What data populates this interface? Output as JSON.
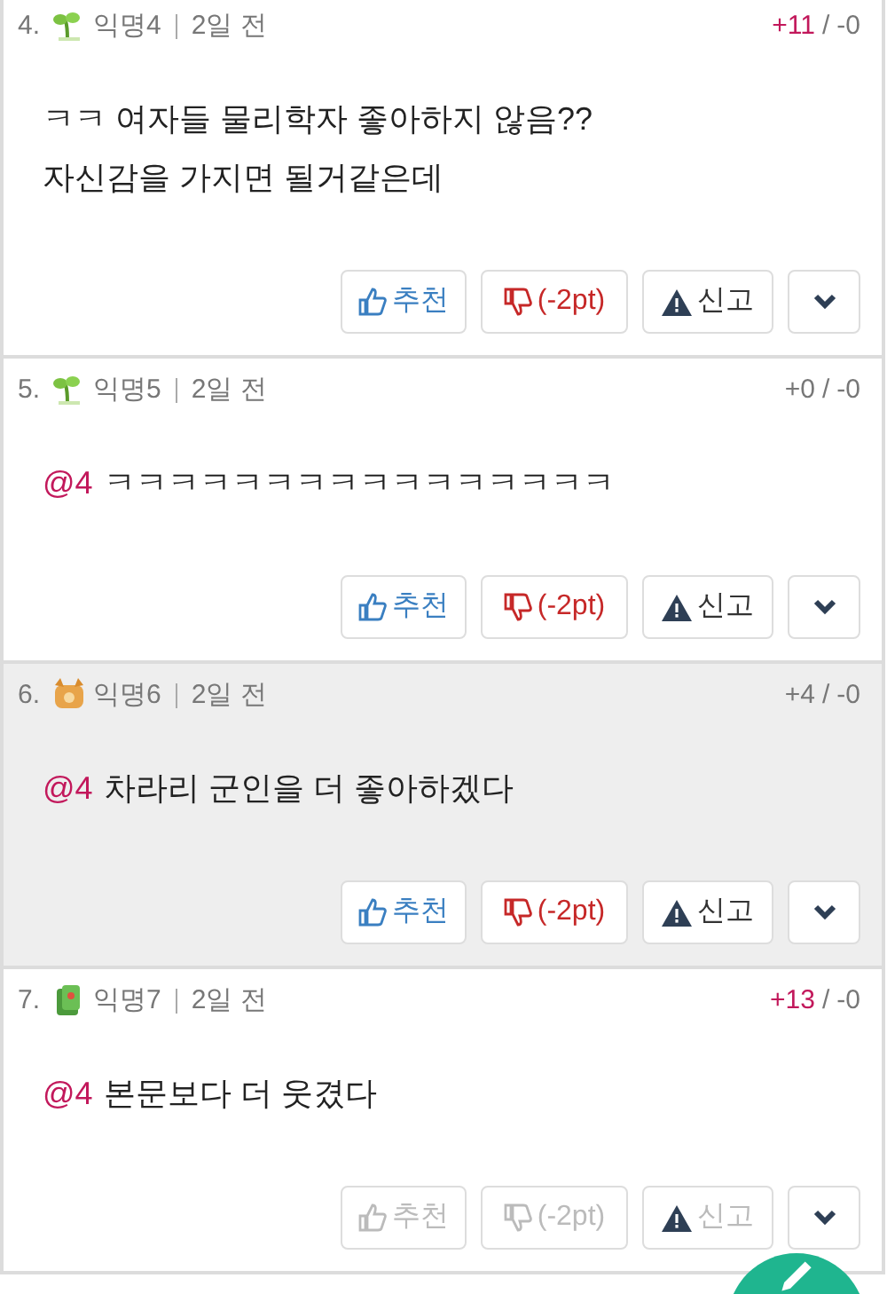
{
  "comments": [
    {
      "number": "4.",
      "avatar": {
        "kind": "sprout"
      },
      "author": "익명4",
      "time": "2일 전",
      "upvotes": "+11",
      "score_separator": "/",
      "downvotes": "-0",
      "hot": true,
      "highlighted": false,
      "lines": [
        "ㅋㅋ 여자들 물리학자 좋아하지 않음??",
        "자신감을 가지면 될거같은데"
      ],
      "buttons": {
        "like": "추천",
        "dislike": "(-2pt)",
        "report": "신고"
      },
      "disabled": false
    },
    {
      "number": "5.",
      "avatar": {
        "kind": "sprout"
      },
      "author": "익명5",
      "time": "2일 전",
      "upvotes": "+0",
      "score_separator": "/",
      "downvotes": "-0",
      "hot": false,
      "highlighted": false,
      "mention": "@4",
      "lines": [
        "ㅋㅋㅋㅋㅋㅋㅋㅋㅋㅋㅋㅋㅋㅋㅋㅋ"
      ],
      "buttons": {
        "like": "추천",
        "dislike": "(-2pt)",
        "report": "신고"
      },
      "disabled": false
    },
    {
      "number": "6.",
      "avatar": {
        "kind": "cat"
      },
      "author": "익명6",
      "time": "2일 전",
      "upvotes": "+4",
      "score_separator": "/",
      "downvotes": "-0",
      "hot": false,
      "highlighted": true,
      "mention": "@4",
      "lines": [
        "차라리 군인을 더 좋아하겠다"
      ],
      "buttons": {
        "like": "추천",
        "dislike": "(-2pt)",
        "report": "신고"
      },
      "disabled": false
    },
    {
      "number": "7.",
      "avatar": {
        "kind": "money"
      },
      "author": "익명7",
      "time": "2일 전",
      "upvotes": "+13",
      "score_separator": "/",
      "downvotes": "-0",
      "hot": true,
      "highlighted": false,
      "mention": "@4",
      "lines": [
        "본문보다 더 웃겼다"
      ],
      "buttons": {
        "like": "추천",
        "dislike": "(-2pt)",
        "report": "신고"
      },
      "disabled": true
    }
  ]
}
